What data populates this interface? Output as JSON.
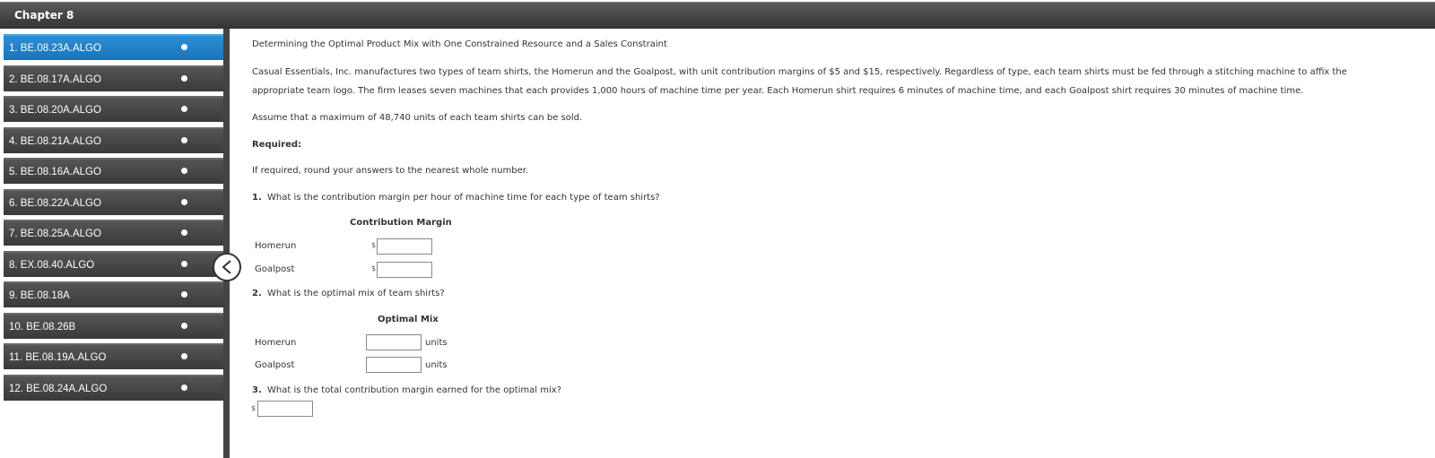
{
  "header": {
    "title": "Chapter 8"
  },
  "sidebar": {
    "items": [
      {
        "label": "1. BE.08.23A.ALGO"
      },
      {
        "label": "2. BE.08.17A.ALGO"
      },
      {
        "label": "3. BE.08.20A.ALGO"
      },
      {
        "label": "4. BE.08.21A.ALGO"
      },
      {
        "label": "5. BE.08.16A.ALGO"
      },
      {
        "label": "6. BE.08.22A.ALGO"
      },
      {
        "label": "7. BE.08.25A.ALGO"
      },
      {
        "label": "8. EX.08.40.ALGO"
      },
      {
        "label": "9. BE.08.18A"
      },
      {
        "label": "10. BE.08.26B"
      },
      {
        "label": "11. BE.08.19A.ALGO"
      },
      {
        "label": "12. BE.08.24A.ALGO"
      }
    ]
  },
  "question": {
    "title": "Determining the Optimal Product Mix with One Constrained Resource and a Sales Constraint",
    "para1_line1": "Casual Essentials, Inc. manufactures two types of team shirts, the Homerun and the Goalpost, with unit contribution margins of $5 and $15, respectively. Regardless of type, each team shirts must be fed through a stitching machine to affix the",
    "para1_line2": "appropriate team logo. The firm leases seven machines that each provides 1,000 hours of machine time per year. Each Homerun shirt requires 6 minutes of machine time, and each Goalpost shirt requires 30 minutes of machine time.",
    "para2": "Assume that a maximum of 48,740 units of each team shirts can be sold.",
    "required_label": "Required:",
    "round_note": "If required, round your answers to the nearest whole number.",
    "q1_number": "1.",
    "q1_text": "What is the contribution margin per hour of machine time for each type of team shirts?",
    "q1_header": "Contribution Margin",
    "q1_rows": [
      {
        "label": "Homerun",
        "currency": "$",
        "value": ""
      },
      {
        "label": "Goalpost",
        "currency": "$",
        "value": ""
      }
    ],
    "q2_number": "2.",
    "q2_text": "What is the optimal mix of team shirts?",
    "q2_header": "Optimal Mix",
    "q2_rows": [
      {
        "label": "Homerun",
        "value": "",
        "unit": "units"
      },
      {
        "label": "Goalpost",
        "value": "",
        "unit": "units"
      }
    ],
    "q3_number": "3.",
    "q3_text": "What is the total contribution margin earned for the optimal mix?",
    "q3_currency": "$",
    "q3_value": ""
  }
}
